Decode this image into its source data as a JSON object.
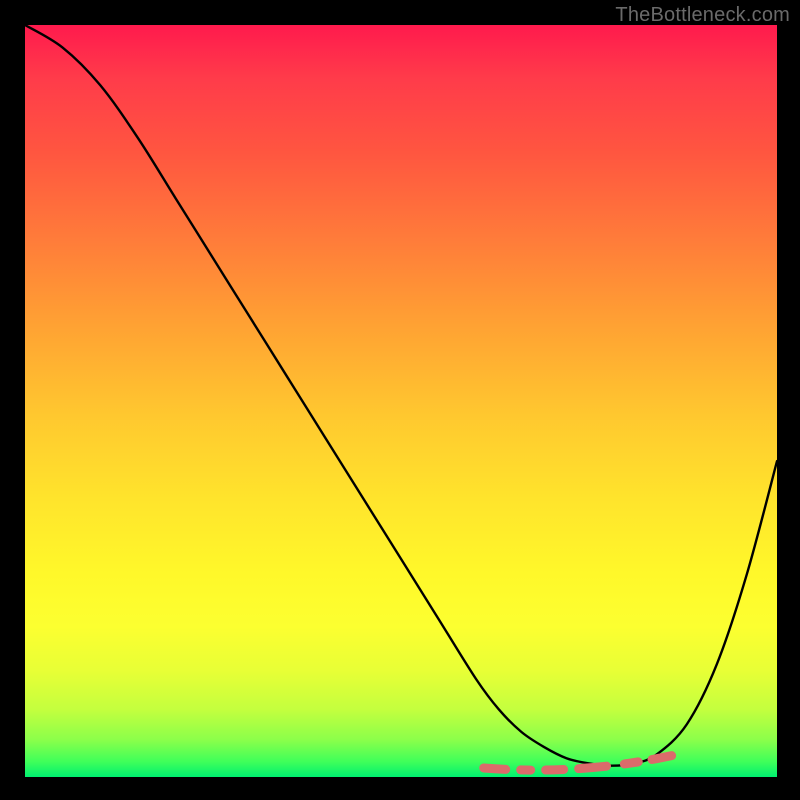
{
  "watermark": "TheBottleneck.com",
  "colors": {
    "curve": "#000000",
    "dash": "#db6b6b",
    "gradient_top": "#ff1a4d",
    "gradient_bottom": "#00f070"
  },
  "chart_data": {
    "type": "line",
    "title": "",
    "xlabel": "",
    "ylabel": "",
    "xlim": [
      0,
      100
    ],
    "ylim": [
      0,
      100
    ],
    "series": [
      {
        "name": "bottleneck-curve",
        "x": [
          0,
          5,
          10,
          15,
          20,
          25,
          30,
          35,
          40,
          45,
          50,
          55,
          60,
          63,
          66,
          69,
          72,
          75,
          78,
          81,
          84,
          88,
          92,
          96,
          100
        ],
        "y": [
          100,
          97,
          92,
          85,
          77,
          69,
          61,
          53,
          45,
          37,
          29,
          21,
          13,
          9,
          6,
          4,
          2.5,
          1.8,
          1.5,
          1.8,
          3,
          7,
          15,
          27,
          42
        ]
      }
    ],
    "annotations": [
      {
        "name": "sweet-spot-dashes",
        "style": "dashed-pink",
        "x_range": [
          61,
          87
        ],
        "approx_y": 2
      }
    ]
  }
}
